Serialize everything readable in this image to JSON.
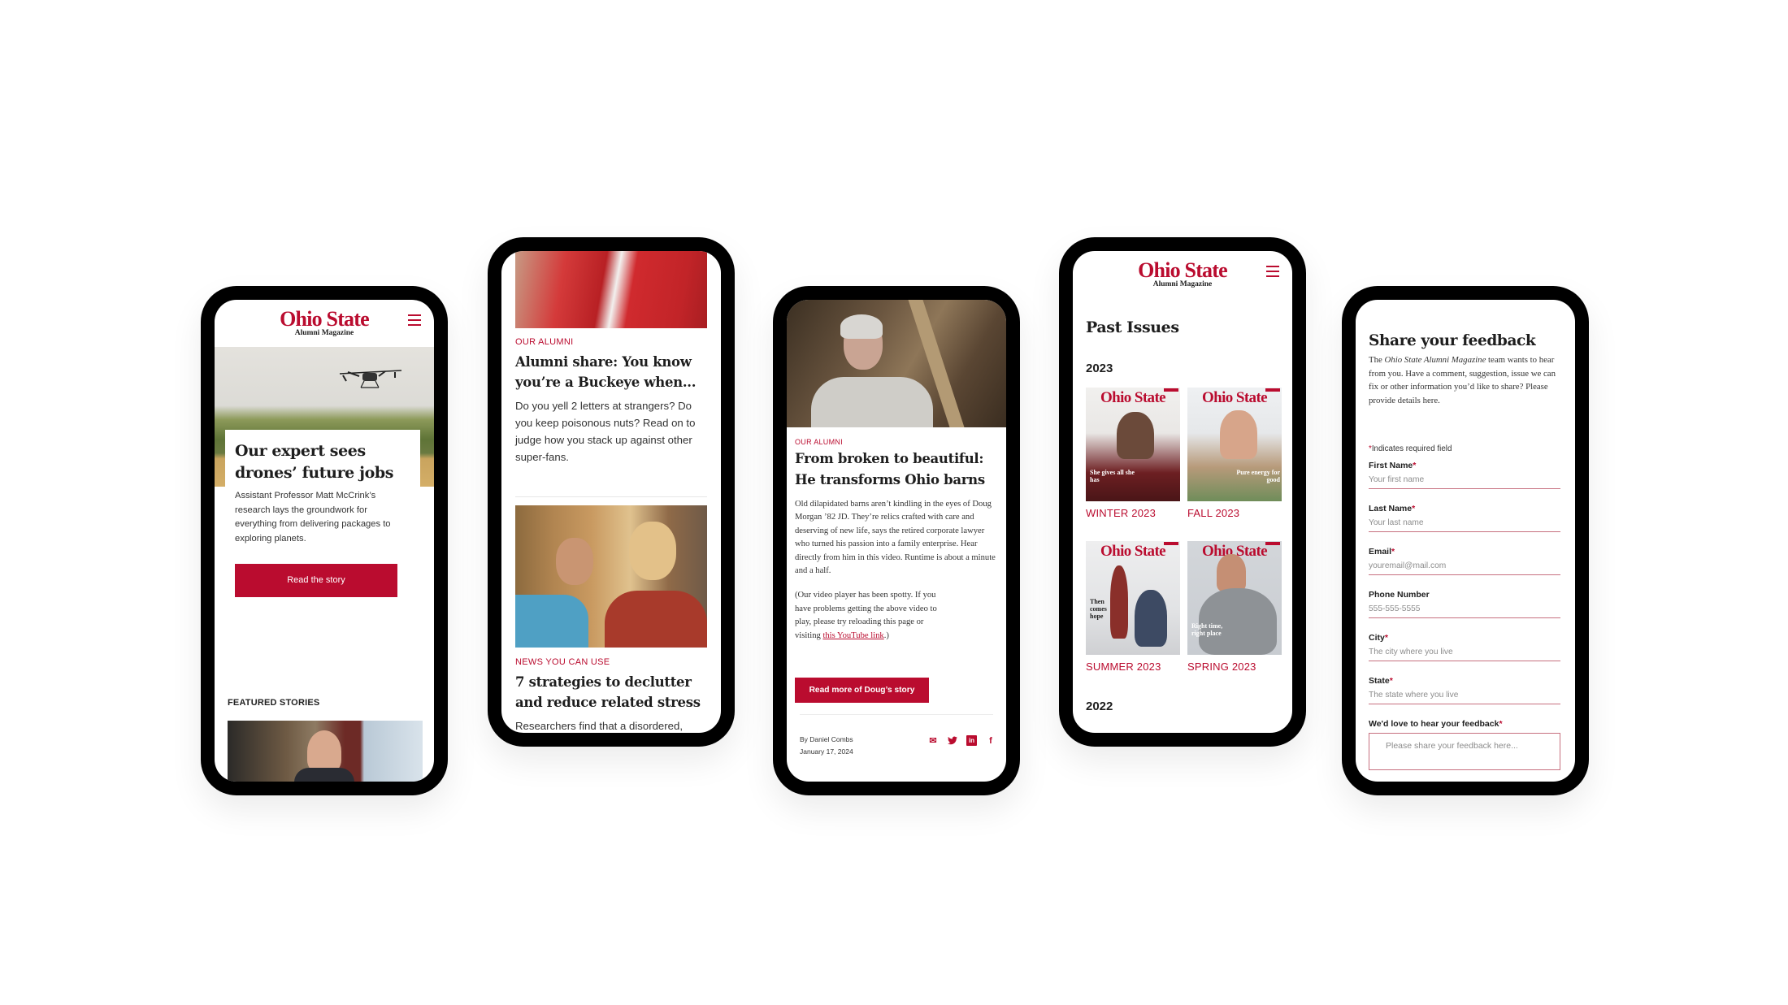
{
  "brand": {
    "logo_main": "Ohio State",
    "logo_sub": "Alumni Magazine",
    "accent_color": "#ba0c2f"
  },
  "phone1": {
    "hero_image": "drone-over-field-photo",
    "headline": "Our expert sees drones’ future jobs",
    "description": "Assistant Professor Matt McCrink’s research lays the groundwork for everything from delivering packages to exploring planets.",
    "cta_label": "Read the story",
    "featured_label": "FEATURED STORIES",
    "featured_image": "man-in-suit-photo"
  },
  "phone2": {
    "articles": [
      {
        "image": "fans-cheering-photo",
        "kicker": "OUR ALUMNI",
        "title": "Alumni share: You know you’re a Buckeye when...",
        "description": "Do you yell 2 letters at strangers? Do you keep poisonous nuts? Read on to judge how you stack up against other super-fans."
      },
      {
        "image": "two-women-decluttering-photo",
        "kicker": "NEWS YOU CAN USE",
        "title": "7 strategies to declutter and reduce related stress",
        "description": "Researchers find that a disordered,"
      }
    ]
  },
  "phone3": {
    "hero_image": "man-in-barn-video",
    "kicker": "OUR ALUMNI",
    "title": "From broken to beautiful: He transforms Ohio barns",
    "body": "Old dilapidated barns aren’t kindling in the eyes of Doug Morgan ’82 JD. They’re relics crafted with care and deserving of new life, says the retired corporate lawyer who turned his passion into a family enterprise. Hear directly from him in this video. Runtime is about a minute and a half.",
    "note_prefix": "(Our video player has been spotty. If you have problems getting the above video to play, please try reloading this page or visiting ",
    "note_link": "this YouTube link",
    "note_suffix": ".)",
    "cta_label": "Read more of Doug’s story",
    "author": "By Daniel Combs",
    "date": "January 17, 2024",
    "share_icons": [
      "email-icon",
      "twitter-icon",
      "linkedin-icon",
      "facebook-icon"
    ],
    "share_glyphs": {
      "email": "✉",
      "twitter": "🐦",
      "linkedin": "in",
      "facebook": "f"
    }
  },
  "phone4": {
    "page_title": "Past Issues",
    "years": [
      {
        "year": "2023",
        "issues": [
          {
            "label": "WINTER 2023",
            "cover_line": "She gives all she has"
          },
          {
            "label": "FALL 2023",
            "cover_line": "Pure energy for good"
          },
          {
            "label": "SUMMER 2023",
            "cover_line": "Then comes hope"
          },
          {
            "label": "SPRING 2023",
            "cover_line": "Right time, right place"
          }
        ]
      },
      {
        "year": "2022",
        "issues": []
      }
    ]
  },
  "phone5": {
    "title": "Share your feedback",
    "intro_prefix": "The ",
    "intro_em": "Ohio State Alumni Magazine",
    "intro_suffix": " team wants to hear from you. Have a comment, suggestion, issue we can fix or other information you’d like to share? Please provide details here.",
    "required_note_asterisk": "*",
    "required_note": "Indicates required field",
    "fields": [
      {
        "label": "First Name",
        "required": "*",
        "placeholder": "Your first name"
      },
      {
        "label": "Last Name",
        "required": "*",
        "placeholder": "Your last name"
      },
      {
        "label": "Email",
        "required": "*",
        "placeholder": "youremail@mail.com"
      },
      {
        "label": "Phone Number",
        "required": "",
        "placeholder": "555-555-5555"
      },
      {
        "label": "City",
        "required": "*",
        "placeholder": "The city where you live"
      },
      {
        "label": "State",
        "required": "*",
        "placeholder": "The state where you live"
      }
    ],
    "feedback_label": "We'd love to hear your feedback",
    "feedback_required": "*",
    "feedback_placeholder": "Please share your feedback here..."
  }
}
